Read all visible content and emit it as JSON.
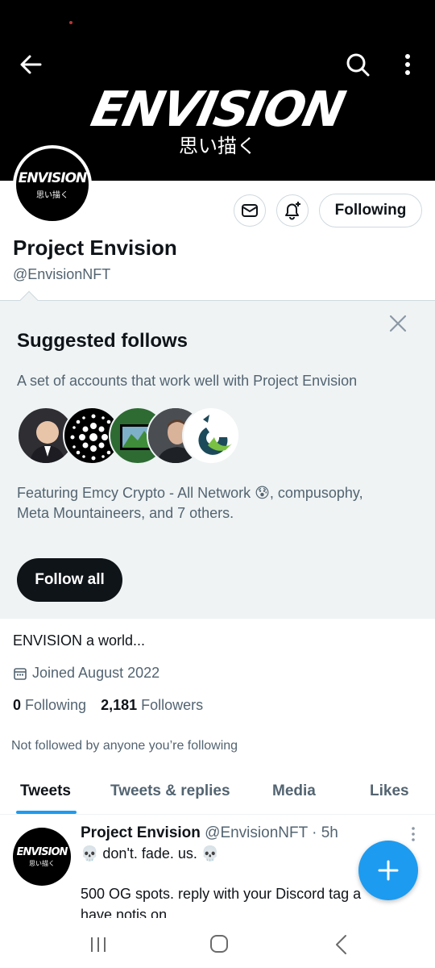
{
  "banner": {
    "logo_text": "ENVISION",
    "logo_subtext": "思い描く"
  },
  "avatar": {
    "logo_text": "ENVISION",
    "logo_subtext": "思い描く"
  },
  "profile": {
    "following_button": "Following",
    "name": "Project Envision",
    "handle": "@EnvisionNFT",
    "bio": "ENVISION a world...",
    "joined": "Joined August 2022",
    "following_count": "0",
    "following_label": "Following",
    "followers_count": "2,181",
    "followers_label": "Followers",
    "not_followed": "Not followed by anyone you’re following"
  },
  "suggested": {
    "title": "Suggested follows",
    "description": "A set of accounts that work well with Project Envision",
    "featuring_line1": "Featuring Emcy Crypto - All Network 😰, compusophy,",
    "featuring_line2": "Meta Mountaineers, and 7 others.",
    "follow_all": "Follow all"
  },
  "tabs": [
    {
      "label": "Tweets",
      "active": true
    },
    {
      "label": "Tweets & replies",
      "active": false
    },
    {
      "label": "Media",
      "active": false
    },
    {
      "label": "Likes",
      "active": false
    }
  ],
  "tweet": {
    "name": "Project Envision",
    "handle_time": " @EnvisionNFT · 5h",
    "line1": "💀 don't. fade. us. 💀",
    "line2": "500 OG spots. reply with your Discord tag a",
    "line3": "have notis on"
  },
  "colors": {
    "accent": "#1d9bf0",
    "text": "#0f1419",
    "muted": "#536471",
    "panel": "#eff3f4"
  }
}
